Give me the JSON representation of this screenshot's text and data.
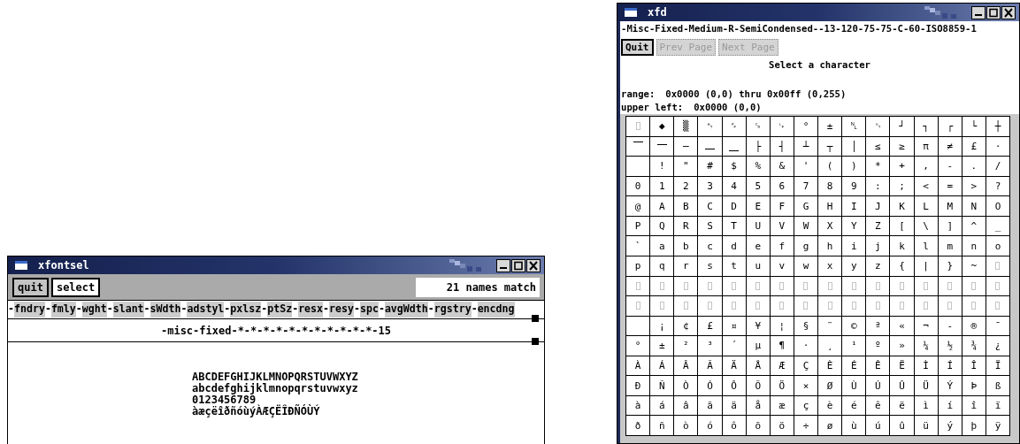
{
  "xfontsel": {
    "title": "xfontsel",
    "buttons": [
      {
        "label": "quit",
        "highlighted": true
      },
      {
        "label": "select",
        "highlighted": false
      }
    ],
    "match_count": "21 names match",
    "separator": "-",
    "fields": [
      "fndry",
      "fmly",
      "wght",
      "slant",
      "sWdth",
      "adstyl",
      "pxlsz",
      "ptSz",
      "resx",
      "resy",
      "spc",
      "avgWdth",
      "rgstry",
      "encdng"
    ],
    "pattern": "-misc-fixed-*-*-*-*-*-*-*-*-*-*-*-15",
    "sample_lines": [
      "ABCDEFGHIJKLMNOPQRSTUVWXYZ",
      "abcdefghijklmnopqrstuvwxyz",
      "0123456789",
      "àæçëîðñóùýÀÆÇËÎÐÑÓÙÝ"
    ]
  },
  "xfd": {
    "title": "xfd",
    "font_name": "-Misc-Fixed-Medium-R-SemiCondensed--13-120-75-75-C-60-ISO8859-1",
    "buttons": [
      {
        "label": "Quit",
        "disabled": false
      },
      {
        "label": "Prev Page",
        "disabled": true
      },
      {
        "label": "Next Page",
        "disabled": true
      }
    ],
    "prompt": "Select a character",
    "range_label": "range:",
    "range_value": "0x0000 (0,0) thru 0x00ff (0,255)",
    "upper_left_label": "upper left:",
    "upper_left_value": "0x0000 (0,0)",
    "grid": [
      [
        {
          "kind": "missing"
        },
        {
          "kind": "char",
          "text": "◆"
        },
        {
          "kind": "char",
          "text": "▒"
        },
        {
          "kind": "char",
          "text": "␉"
        },
        {
          "kind": "char",
          "text": "␌"
        },
        {
          "kind": "char",
          "text": "␍"
        },
        {
          "kind": "char",
          "text": "␊"
        },
        {
          "kind": "char",
          "text": "°"
        },
        {
          "kind": "char",
          "text": "±"
        },
        {
          "kind": "char",
          "text": "␤"
        },
        {
          "kind": "char",
          "text": "␋"
        },
        {
          "kind": "char",
          "text": "┘"
        },
        {
          "kind": "char",
          "text": "┐"
        },
        {
          "kind": "char",
          "text": "┌"
        },
        {
          "kind": "char",
          "text": "└"
        },
        {
          "kind": "char",
          "text": "┼"
        }
      ],
      [
        {
          "kind": "char",
          "text": "⎺"
        },
        {
          "kind": "char",
          "text": "⎻"
        },
        {
          "kind": "char",
          "text": "─"
        },
        {
          "kind": "char",
          "text": "⎼"
        },
        {
          "kind": "char",
          "text": "⎽"
        },
        {
          "kind": "char",
          "text": "├"
        },
        {
          "kind": "char",
          "text": "┤"
        },
        {
          "kind": "char",
          "text": "┴"
        },
        {
          "kind": "char",
          "text": "┬"
        },
        {
          "kind": "char",
          "text": "│"
        },
        {
          "kind": "char",
          "text": "≤"
        },
        {
          "kind": "char",
          "text": "≥"
        },
        {
          "kind": "char",
          "text": "π"
        },
        {
          "kind": "char",
          "text": "≠"
        },
        {
          "kind": "char",
          "text": "£"
        },
        {
          "kind": "char",
          "text": "·"
        }
      ],
      [
        {
          "kind": "blank"
        },
        {
          "kind": "char",
          "text": "!"
        },
        {
          "kind": "char",
          "text": "\""
        },
        {
          "kind": "char",
          "text": "#"
        },
        {
          "kind": "char",
          "text": "$"
        },
        {
          "kind": "char",
          "text": "%"
        },
        {
          "kind": "char",
          "text": "&"
        },
        {
          "kind": "char",
          "text": "'"
        },
        {
          "kind": "char",
          "text": "("
        },
        {
          "kind": "char",
          "text": ")"
        },
        {
          "kind": "char",
          "text": "*"
        },
        {
          "kind": "char",
          "text": "+"
        },
        {
          "kind": "char",
          "text": ","
        },
        {
          "kind": "char",
          "text": "-"
        },
        {
          "kind": "char",
          "text": "."
        },
        {
          "kind": "char",
          "text": "/"
        }
      ],
      [
        {
          "kind": "char",
          "text": "0"
        },
        {
          "kind": "char",
          "text": "1"
        },
        {
          "kind": "char",
          "text": "2"
        },
        {
          "kind": "char",
          "text": "3"
        },
        {
          "kind": "char",
          "text": "4"
        },
        {
          "kind": "char",
          "text": "5"
        },
        {
          "kind": "char",
          "text": "6"
        },
        {
          "kind": "char",
          "text": "7"
        },
        {
          "kind": "char",
          "text": "8"
        },
        {
          "kind": "char",
          "text": "9"
        },
        {
          "kind": "char",
          "text": ":"
        },
        {
          "kind": "char",
          "text": ";"
        },
        {
          "kind": "char",
          "text": "<"
        },
        {
          "kind": "char",
          "text": "="
        },
        {
          "kind": "char",
          "text": ">"
        },
        {
          "kind": "char",
          "text": "?"
        }
      ],
      [
        {
          "kind": "char",
          "text": "@"
        },
        {
          "kind": "char",
          "text": "A"
        },
        {
          "kind": "char",
          "text": "B"
        },
        {
          "kind": "char",
          "text": "C"
        },
        {
          "kind": "char",
          "text": "D"
        },
        {
          "kind": "char",
          "text": "E"
        },
        {
          "kind": "char",
          "text": "F"
        },
        {
          "kind": "char",
          "text": "G"
        },
        {
          "kind": "char",
          "text": "H"
        },
        {
          "kind": "char",
          "text": "I"
        },
        {
          "kind": "char",
          "text": "J"
        },
        {
          "kind": "char",
          "text": "K"
        },
        {
          "kind": "char",
          "text": "L"
        },
        {
          "kind": "char",
          "text": "M"
        },
        {
          "kind": "char",
          "text": "N"
        },
        {
          "kind": "char",
          "text": "O"
        }
      ],
      [
        {
          "kind": "char",
          "text": "P"
        },
        {
          "kind": "char",
          "text": "Q"
        },
        {
          "kind": "char",
          "text": "R"
        },
        {
          "kind": "char",
          "text": "S"
        },
        {
          "kind": "char",
          "text": "T"
        },
        {
          "kind": "char",
          "text": "U"
        },
        {
          "kind": "char",
          "text": "V"
        },
        {
          "kind": "char",
          "text": "W"
        },
        {
          "kind": "char",
          "text": "X"
        },
        {
          "kind": "char",
          "text": "Y"
        },
        {
          "kind": "char",
          "text": "Z"
        },
        {
          "kind": "char",
          "text": "["
        },
        {
          "kind": "char",
          "text": "\\"
        },
        {
          "kind": "char",
          "text": "]"
        },
        {
          "kind": "char",
          "text": "^"
        },
        {
          "kind": "char",
          "text": "_"
        }
      ],
      [
        {
          "kind": "char",
          "text": "`"
        },
        {
          "kind": "char",
          "text": "a"
        },
        {
          "kind": "char",
          "text": "b"
        },
        {
          "kind": "char",
          "text": "c"
        },
        {
          "kind": "char",
          "text": "d"
        },
        {
          "kind": "char",
          "text": "e"
        },
        {
          "kind": "char",
          "text": "f"
        },
        {
          "kind": "char",
          "text": "g"
        },
        {
          "kind": "char",
          "text": "h"
        },
        {
          "kind": "char",
          "text": "i"
        },
        {
          "kind": "char",
          "text": "j"
        },
        {
          "kind": "char",
          "text": "k"
        },
        {
          "kind": "char",
          "text": "l"
        },
        {
          "kind": "char",
          "text": "m"
        },
        {
          "kind": "char",
          "text": "n"
        },
        {
          "kind": "char",
          "text": "o"
        }
      ],
      [
        {
          "kind": "char",
          "text": "p"
        },
        {
          "kind": "char",
          "text": "q"
        },
        {
          "kind": "char",
          "text": "r"
        },
        {
          "kind": "char",
          "text": "s"
        },
        {
          "kind": "char",
          "text": "t"
        },
        {
          "kind": "char",
          "text": "u"
        },
        {
          "kind": "char",
          "text": "v"
        },
        {
          "kind": "char",
          "text": "w"
        },
        {
          "kind": "char",
          "text": "x"
        },
        {
          "kind": "char",
          "text": "y"
        },
        {
          "kind": "char",
          "text": "z"
        },
        {
          "kind": "char",
          "text": "{"
        },
        {
          "kind": "char",
          "text": "|"
        },
        {
          "kind": "char",
          "text": "}"
        },
        {
          "kind": "char",
          "text": "~"
        },
        {
          "kind": "missing"
        }
      ],
      [
        {
          "kind": "missing"
        },
        {
          "kind": "missing"
        },
        {
          "kind": "missing"
        },
        {
          "kind": "missing"
        },
        {
          "kind": "missing"
        },
        {
          "kind": "missing"
        },
        {
          "kind": "missing"
        },
        {
          "kind": "missing"
        },
        {
          "kind": "missing"
        },
        {
          "kind": "missing"
        },
        {
          "kind": "missing"
        },
        {
          "kind": "missing"
        },
        {
          "kind": "missing"
        },
        {
          "kind": "missing"
        },
        {
          "kind": "missing"
        },
        {
          "kind": "missing"
        }
      ],
      [
        {
          "kind": "missing"
        },
        {
          "kind": "missing"
        },
        {
          "kind": "missing"
        },
        {
          "kind": "missing"
        },
        {
          "kind": "missing"
        },
        {
          "kind": "missing"
        },
        {
          "kind": "missing"
        },
        {
          "kind": "missing"
        },
        {
          "kind": "missing"
        },
        {
          "kind": "missing"
        },
        {
          "kind": "missing"
        },
        {
          "kind": "missing"
        },
        {
          "kind": "missing"
        },
        {
          "kind": "missing"
        },
        {
          "kind": "missing"
        },
        {
          "kind": "missing"
        }
      ],
      [
        {
          "kind": "blank"
        },
        {
          "kind": "char",
          "text": "¡"
        },
        {
          "kind": "char",
          "text": "¢"
        },
        {
          "kind": "char",
          "text": "£"
        },
        {
          "kind": "char",
          "text": "¤"
        },
        {
          "kind": "char",
          "text": "¥"
        },
        {
          "kind": "char",
          "text": "¦"
        },
        {
          "kind": "char",
          "text": "§"
        },
        {
          "kind": "char",
          "text": "¨"
        },
        {
          "kind": "char",
          "text": "©"
        },
        {
          "kind": "char",
          "text": "ª"
        },
        {
          "kind": "char",
          "text": "«"
        },
        {
          "kind": "char",
          "text": "¬"
        },
        {
          "kind": "char",
          "text": "-"
        },
        {
          "kind": "char",
          "text": "®"
        },
        {
          "kind": "char",
          "text": "¯"
        }
      ],
      [
        {
          "kind": "char",
          "text": "°"
        },
        {
          "kind": "char",
          "text": "±"
        },
        {
          "kind": "char",
          "text": "²"
        },
        {
          "kind": "char",
          "text": "³"
        },
        {
          "kind": "char",
          "text": "´"
        },
        {
          "kind": "char",
          "text": "µ"
        },
        {
          "kind": "char",
          "text": "¶"
        },
        {
          "kind": "char",
          "text": "·"
        },
        {
          "kind": "char",
          "text": "¸"
        },
        {
          "kind": "char",
          "text": "¹"
        },
        {
          "kind": "char",
          "text": "º"
        },
        {
          "kind": "char",
          "text": "»"
        },
        {
          "kind": "char",
          "text": "¼"
        },
        {
          "kind": "char",
          "text": "½"
        },
        {
          "kind": "char",
          "text": "¾"
        },
        {
          "kind": "char",
          "text": "¿"
        }
      ],
      [
        {
          "kind": "char",
          "text": "À"
        },
        {
          "kind": "char",
          "text": "Á"
        },
        {
          "kind": "char",
          "text": "Â"
        },
        {
          "kind": "char",
          "text": "Ã"
        },
        {
          "kind": "char",
          "text": "Ä"
        },
        {
          "kind": "char",
          "text": "Å"
        },
        {
          "kind": "char",
          "text": "Æ"
        },
        {
          "kind": "char",
          "text": "Ç"
        },
        {
          "kind": "char",
          "text": "È"
        },
        {
          "kind": "char",
          "text": "É"
        },
        {
          "kind": "char",
          "text": "Ê"
        },
        {
          "kind": "char",
          "text": "Ë"
        },
        {
          "kind": "char",
          "text": "Ì"
        },
        {
          "kind": "char",
          "text": "Í"
        },
        {
          "kind": "char",
          "text": "Î"
        },
        {
          "kind": "char",
          "text": "Ï"
        }
      ],
      [
        {
          "kind": "char",
          "text": "Ð"
        },
        {
          "kind": "char",
          "text": "Ñ"
        },
        {
          "kind": "char",
          "text": "Ò"
        },
        {
          "kind": "char",
          "text": "Ó"
        },
        {
          "kind": "char",
          "text": "Ô"
        },
        {
          "kind": "char",
          "text": "Õ"
        },
        {
          "kind": "char",
          "text": "Ö"
        },
        {
          "kind": "char",
          "text": "×"
        },
        {
          "kind": "char",
          "text": "Ø"
        },
        {
          "kind": "char",
          "text": "Ù"
        },
        {
          "kind": "char",
          "text": "Ú"
        },
        {
          "kind": "char",
          "text": "Û"
        },
        {
          "kind": "char",
          "text": "Ü"
        },
        {
          "kind": "char",
          "text": "Ý"
        },
        {
          "kind": "char",
          "text": "Þ"
        },
        {
          "kind": "char",
          "text": "ß"
        }
      ],
      [
        {
          "kind": "char",
          "text": "à"
        },
        {
          "kind": "char",
          "text": "á"
        },
        {
          "kind": "char",
          "text": "â"
        },
        {
          "kind": "char",
          "text": "ã"
        },
        {
          "kind": "char",
          "text": "ä"
        },
        {
          "kind": "char",
          "text": "å"
        },
        {
          "kind": "char",
          "text": "æ"
        },
        {
          "kind": "char",
          "text": "ç"
        },
        {
          "kind": "char",
          "text": "è"
        },
        {
          "kind": "char",
          "text": "é"
        },
        {
          "kind": "char",
          "text": "ê"
        },
        {
          "kind": "char",
          "text": "ë"
        },
        {
          "kind": "char",
          "text": "ì"
        },
        {
          "kind": "char",
          "text": "í"
        },
        {
          "kind": "char",
          "text": "î"
        },
        {
          "kind": "char",
          "text": "ï"
        }
      ],
      [
        {
          "kind": "char",
          "text": "ð"
        },
        {
          "kind": "char",
          "text": "ñ"
        },
        {
          "kind": "char",
          "text": "ò"
        },
        {
          "kind": "char",
          "text": "ó"
        },
        {
          "kind": "char",
          "text": "ô"
        },
        {
          "kind": "char",
          "text": "õ"
        },
        {
          "kind": "char",
          "text": "ö"
        },
        {
          "kind": "char",
          "text": "÷"
        },
        {
          "kind": "char",
          "text": "ø"
        },
        {
          "kind": "char",
          "text": "ù"
        },
        {
          "kind": "char",
          "text": "ú"
        },
        {
          "kind": "char",
          "text": "û"
        },
        {
          "kind": "char",
          "text": "ü"
        },
        {
          "kind": "char",
          "text": "ý"
        },
        {
          "kind": "char",
          "text": "þ"
        },
        {
          "kind": "char",
          "text": "ÿ"
        }
      ]
    ]
  }
}
